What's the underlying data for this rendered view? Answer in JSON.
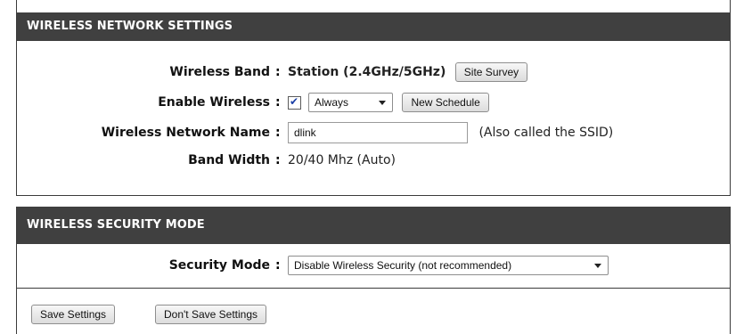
{
  "wireless_section": {
    "title": "WIRELESS NETWORK SETTINGS",
    "wireless_band": {
      "label": "Wireless Band",
      "value": "Station (2.4GHz/5GHz)",
      "button": "Site Survey"
    },
    "enable_wireless": {
      "label": "Enable Wireless",
      "checked": true,
      "schedule_value": "Always",
      "button": "New Schedule"
    },
    "network_name": {
      "label": "Wireless Network Name",
      "value": "dlink",
      "hint": "(Also called the SSID)"
    },
    "band_width": {
      "label": "Band Width",
      "value": "20/40 Mhz (Auto)"
    }
  },
  "security_section": {
    "title": "WIRELESS SECURITY MODE",
    "security_mode": {
      "label": "Security Mode",
      "value": "Disable Wireless Security (not recommended)"
    }
  },
  "actions": {
    "save": "Save Settings",
    "dont_save": "Don't Save Settings"
  },
  "colon": ":"
}
